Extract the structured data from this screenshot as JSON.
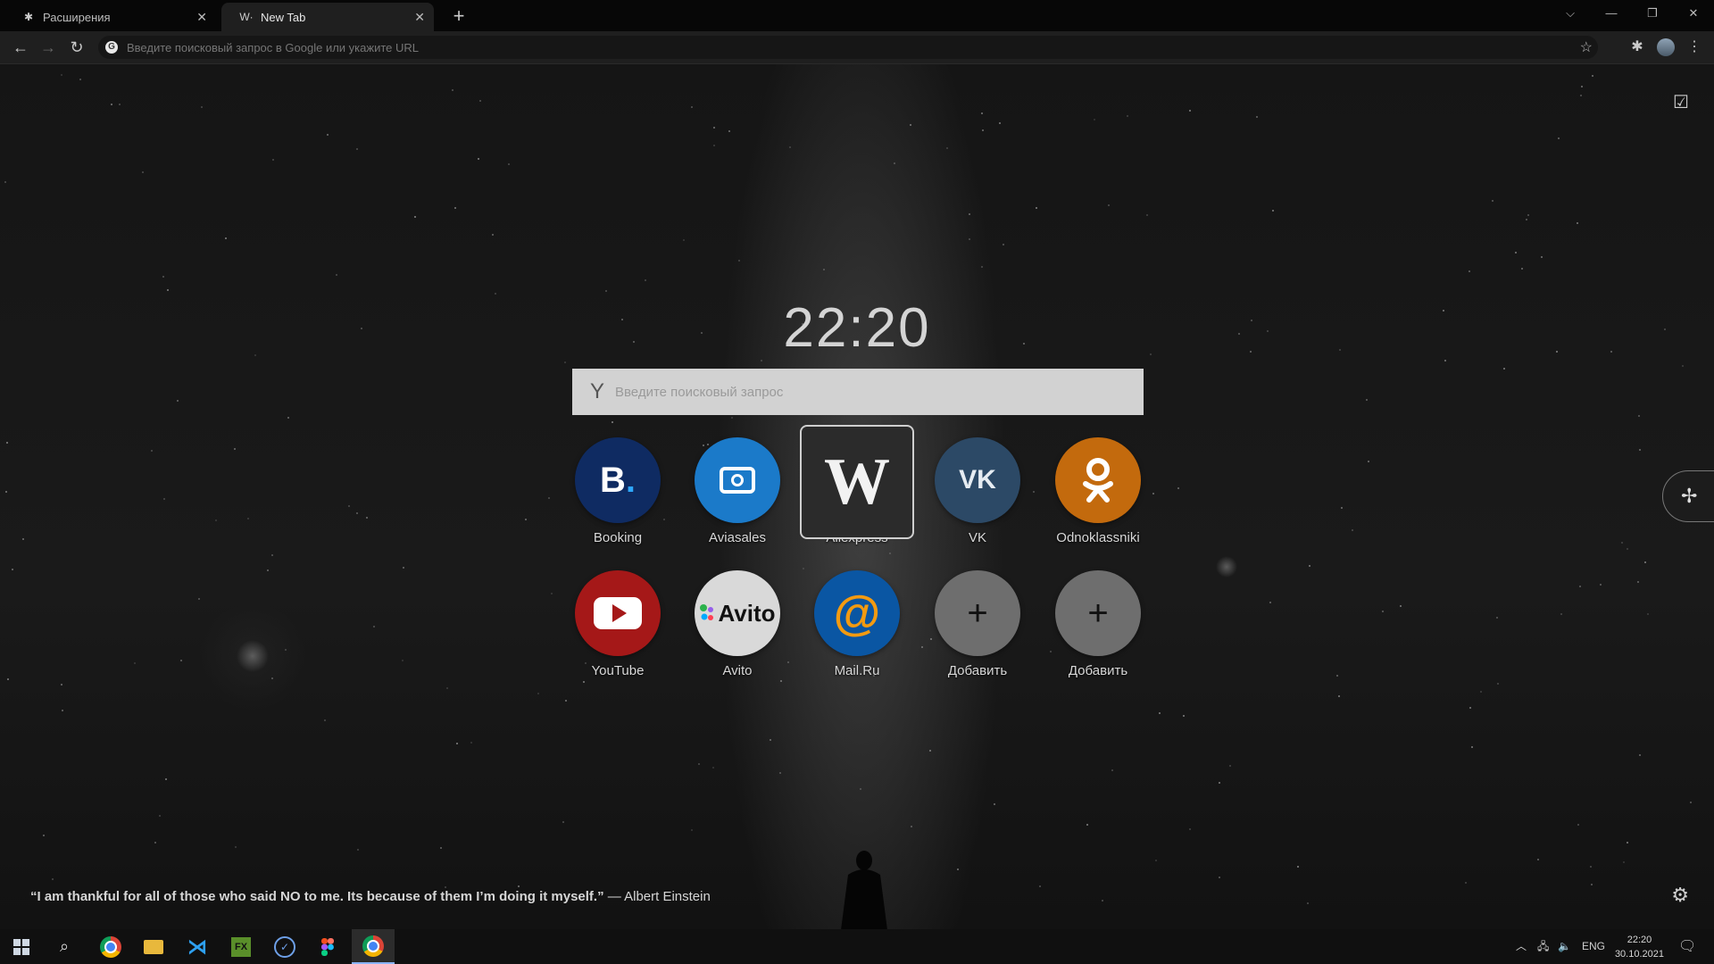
{
  "tabs": [
    {
      "icon": "puzzle-icon",
      "title": "Расширения"
    },
    {
      "icon": "w-logo-icon",
      "title": "New Tab",
      "active": true
    }
  ],
  "omnibox": {
    "placeholder": "Введите поисковый запрос в Google или укажите URL"
  },
  "ntp": {
    "clock": "22:20",
    "search_placeholder": "Введите поисковый запрос",
    "dials": [
      {
        "label": "Booking",
        "color": "#0f2b62",
        "glyph": "B."
      },
      {
        "label": "Aviasales",
        "color": "#1b7ac9",
        "glyph": "✈"
      },
      {
        "label": "Aliexpress",
        "color": "#2b2b2b",
        "glyph": "W"
      },
      {
        "label": "VK",
        "color": "#2c4966",
        "glyph": "VK"
      },
      {
        "label": "Odnoklassniki",
        "color": "#c36a0d",
        "glyph": "OK"
      },
      {
        "label": "YouTube",
        "color": "#a51818",
        "glyph": "▶"
      },
      {
        "label": "Avito",
        "color": "#d9d9d9",
        "glyph": "Avito"
      },
      {
        "label": "Mail.Ru",
        "color": "#0a56a3",
        "glyph": "@"
      },
      {
        "label": "Добавить",
        "color": "#6e6e6e",
        "glyph": "+"
      },
      {
        "label": "Добавить",
        "color": "#6e6e6e",
        "glyph": "+"
      }
    ],
    "quote": {
      "text": "“I am thankful for all of those who said NO to me. Its because of them I’m doing it myself.”",
      "author": " — Albert Einstein"
    }
  },
  "taskbar": {
    "apps": [
      "windows-start-icon",
      "search-icon",
      "chrome-icon",
      "file-explorer-icon",
      "vscode-icon",
      "terminal-icon",
      "todo-icon",
      "figma-icon",
      "chrome-active-icon"
    ],
    "lang": "ENG",
    "time": "22:20",
    "date": "30.10.2021"
  }
}
